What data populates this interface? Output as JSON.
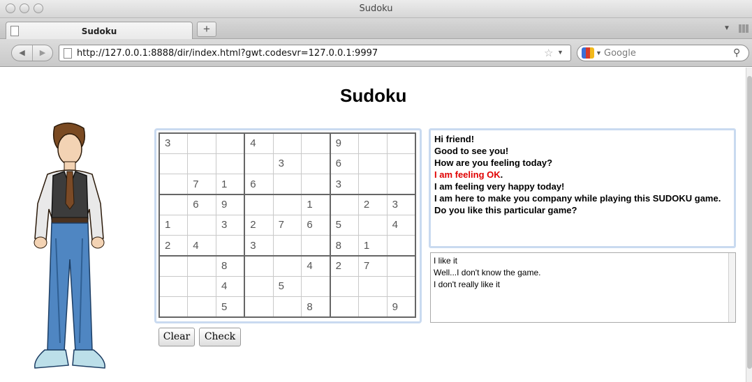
{
  "window": {
    "title": "Sudoku"
  },
  "tabs": [
    {
      "label": "Sudoku"
    }
  ],
  "newtab_label": "+",
  "address": {
    "url": "http://127.0.0.1:8888/dir/index.html?gwt.codesvr=127.0.0.1:9997",
    "search_placeholder": "Google"
  },
  "page": {
    "title": "Sudoku",
    "board": [
      [
        "3",
        "",
        "",
        "4",
        "",
        "",
        "9",
        "",
        ""
      ],
      [
        "",
        "",
        "",
        "",
        "3",
        "",
        "6",
        "",
        ""
      ],
      [
        "",
        "7",
        "1",
        "6",
        "",
        "",
        "3",
        "",
        ""
      ],
      [
        "",
        "6",
        "9",
        "",
        "",
        "1",
        "",
        "2",
        "3"
      ],
      [
        "1",
        "",
        "3",
        "2",
        "7",
        "6",
        "5",
        "",
        "4"
      ],
      [
        "2",
        "4",
        "",
        "3",
        "",
        "",
        "8",
        "1",
        ""
      ],
      [
        "",
        "",
        "8",
        "",
        "",
        "4",
        "2",
        "7",
        ""
      ],
      [
        "",
        "",
        "4",
        "",
        "5",
        "",
        "",
        "",
        ""
      ],
      [
        "",
        "",
        "5",
        "",
        "",
        "8",
        "",
        "",
        "9"
      ]
    ],
    "buttons": {
      "clear": "Clear",
      "check": "Check"
    },
    "speech": [
      {
        "text": "Hi friend!"
      },
      {
        "text": "Good to see you!"
      },
      {
        "text": "How are you feeling today?"
      },
      {
        "text": "I am feeling OK",
        "highlight": true,
        "suffix": "."
      },
      {
        "text": "I am feeling very happy today!"
      },
      {
        "text": "I am here to make you company while playing this SUDOKU game."
      },
      {
        "text": "Do you like this particular game?"
      }
    ],
    "replies": [
      "I like it",
      "Well...I don't know the game.",
      "I don't really like it"
    ]
  },
  "colors": {
    "highlight": "#e00000",
    "panel_border": "#c9daf0"
  }
}
